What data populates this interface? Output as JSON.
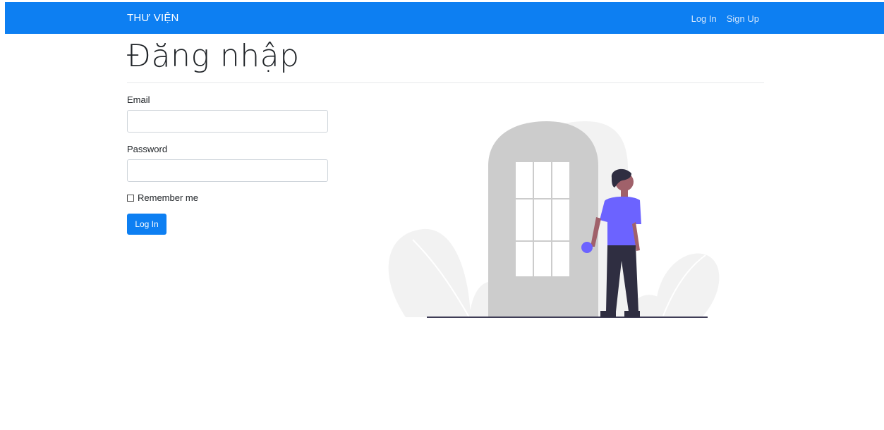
{
  "navbar": {
    "brand": "THƯ VIỆN",
    "links": [
      {
        "label": "Log In"
      },
      {
        "label": "Sign Up"
      }
    ],
    "color": "#0d7ff2"
  },
  "page": {
    "title": "Đăng nhập"
  },
  "form": {
    "email_label": "Email",
    "email_value": "",
    "password_label": "Password",
    "password_value": "",
    "remember_label": "Remember me",
    "remember_checked": false,
    "submit_label": "Log In"
  },
  "illustration": {
    "icon": "person-at-door-illustration",
    "accent_color": "#6c63ff"
  }
}
